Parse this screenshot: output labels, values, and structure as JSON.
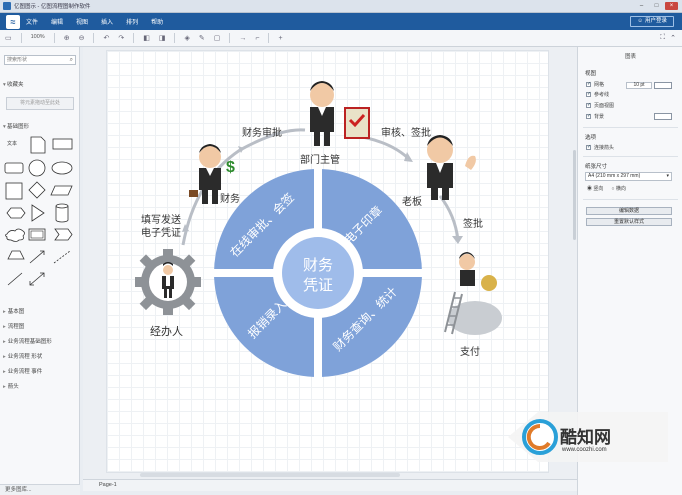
{
  "window": {
    "title": "亿图图示 - 亿图流程图制作软件"
  },
  "menu": {
    "items": [
      "文件",
      "编辑",
      "视图",
      "插入",
      "排列",
      "帮助"
    ],
    "login": "用户登录"
  },
  "toolbar": {
    "zoom": "100%"
  },
  "sidebar": {
    "search_placeholder": "搜索形状",
    "section_favorites": "收藏夹",
    "hint": "将元素拖动至此处",
    "section_basic": "基础图形",
    "text_shape": "文本",
    "lists": [
      "基本图",
      "流程图",
      "业务流程基础图形",
      "业务流程 形状",
      "业务流程 事件",
      "箭头"
    ],
    "more": "更多图库..."
  },
  "pagebar": {
    "page": "Page-1"
  },
  "right_panel": {
    "title": "图表",
    "view_label": "视图",
    "grid": "网格",
    "grid_size": "10 pt",
    "guides": "参考线",
    "page_view": "页面视图",
    "background": "背景",
    "options_label": "选项",
    "connection_arrows": "连接箭头",
    "paper_label": "纸张尺寸",
    "paper": "A4 (210 mm x 297 mm)",
    "portrait": "竖向",
    "landscape": "横向",
    "edit_data": "编辑数据",
    "reset_style": "重置默认样式"
  },
  "diagram": {
    "center": [
      "财务",
      "凭证"
    ],
    "quadrants": [
      "在线审批、会签",
      "电子印章",
      "报销录入",
      "财务查询、统计"
    ],
    "labels": {
      "finance_approval": "财务审批",
      "dept_head": "部门主管",
      "review_sign": "审核、签批",
      "finance": "财务",
      "boss": "老板",
      "fill_send_1": "填写发送",
      "fill_send_2": "电子凭证",
      "approve": "签批",
      "handler": "经办人",
      "pay": "支付"
    }
  },
  "watermark": {
    "brand": "酷知网",
    "url": "www.coozhi.com"
  },
  "colors": {
    "accent": "#1f5b9e",
    "quadrant": "#7fa2d9",
    "center": "#9fbcea"
  }
}
